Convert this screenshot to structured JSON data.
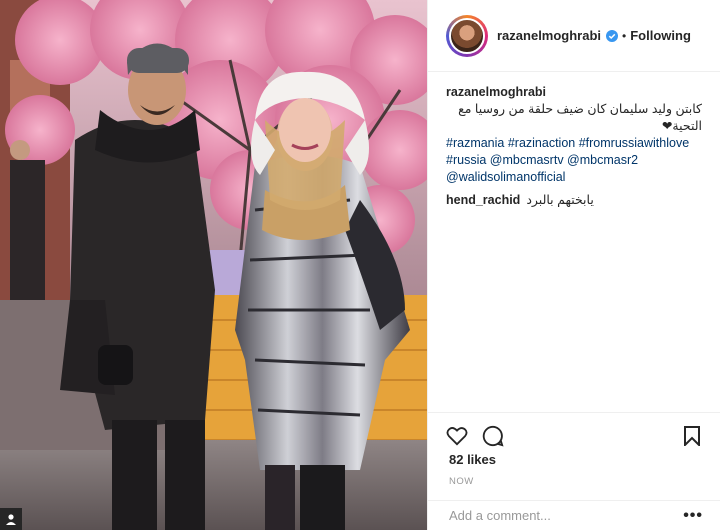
{
  "post": {
    "username": "razanelmoghrabi",
    "follow_status": "Following",
    "caption_user": "razanelmoghrabi",
    "caption_arabic": "كابتن وليد سليمان كان ضيف حلقة من روسيا مع التحية❤",
    "hashtags_line1": "#razmania #razinaction #fromrussiawithlove",
    "hashtags_line2": "#russia @mbcmasrtv @mbcmasr2",
    "hashtags_line3": "@walidsolimanofficial",
    "comment_user": "hend_rachid",
    "comment_text": "يابختهم بالبرد",
    "likes": "82 likes",
    "time": "NOW",
    "comment_placeholder": "Add a comment...",
    "more": "•••"
  },
  "icons": [
    "verified-badge-icon",
    "heart-icon",
    "comment-icon",
    "bookmark-icon",
    "profile-icon"
  ],
  "colors": {
    "link": "#003569",
    "text": "#262626",
    "verified": "#3897f0",
    "muted": "#999999"
  }
}
